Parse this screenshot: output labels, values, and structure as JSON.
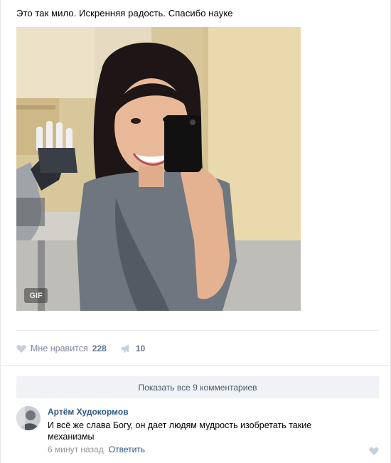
{
  "post": {
    "text": "Это так мило. Искренняя радость. Спасибо науке",
    "media": {
      "badge": "GIF"
    },
    "actions": {
      "like_label": "Мне нравится",
      "like_count": "228",
      "share_count": "10"
    },
    "show_comments": "Показать все 9 комментариев"
  },
  "comment": {
    "author": "Артём Худокормов",
    "text": "И всё же слава Богу, он дает людям мудрость изобретать такие механизмы",
    "time": "6 минут назад",
    "reply_label": "Ответить"
  },
  "colors": {
    "link": "#2a5885",
    "muted": "#939393",
    "icon": "#c5d0db"
  }
}
